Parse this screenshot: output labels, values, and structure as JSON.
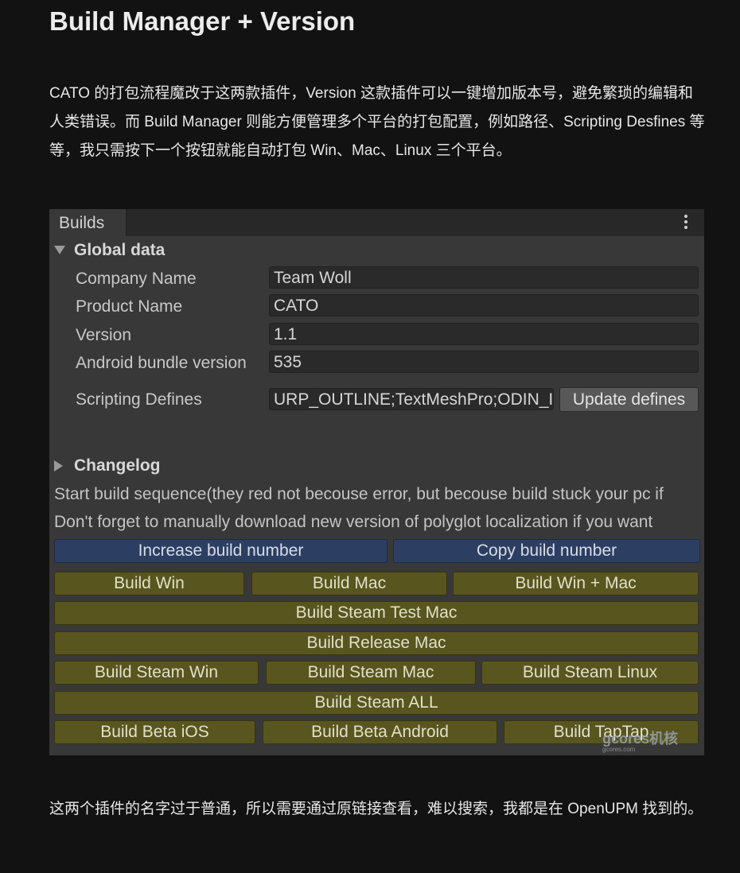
{
  "article": {
    "title": "Build Manager + Version",
    "paragraph1": "CATO 的打包流程魔改于这两款插件，Version 这款插件可以一键增加版本号，避免繁琐的编辑和人类错误。而 Build Manager 则能方便管理多个平台的打包配置，例如路径、Scripting Desfines 等等，我只需按下一个按钮就能自动打包 Win、Mac、Linux 三个平台。",
    "paragraph2": "这两个插件的名字过于普通，所以需要通过原链接查看，难以搜索，我都是在 OpenUPM 找到的。",
    "watermark": "gcores机核",
    "watermark_sub": "gcores.com"
  },
  "window": {
    "tab_label": "Builds",
    "menu_icon": "kebab-menu-icon"
  },
  "global_data": {
    "header": "Global data",
    "fields": [
      {
        "label": "Company Name",
        "value": "Team Woll"
      },
      {
        "label": "Product Name",
        "value": "CATO"
      },
      {
        "label": "Version",
        "value": "1.1"
      },
      {
        "label": "Android bundle version",
        "value": "535"
      }
    ],
    "scripting": {
      "label": "Scripting Defines",
      "value": "URP_OUTLINE;TextMeshPro;ODIN_INSPECTOR",
      "button": "Update defines"
    }
  },
  "changelog": {
    "header": "Changelog",
    "info_line1": "Start build sequence(they red not becouse error, but becouse build stuck your pc if",
    "info_line2": "Don't forget to manually download new version of polyglot localization if you want"
  },
  "buttons": {
    "increase": "Increase build number",
    "copy": "Copy build number",
    "build_win": "Build Win",
    "build_mac": "Build Mac",
    "build_win_mac": "Build Win + Mac",
    "steam_test_mac": "Build Steam Test Mac",
    "release_mac": "Build Release Mac",
    "steam_win": "Build Steam Win",
    "steam_mac": "Build Steam Mac",
    "steam_linux": "Build Steam Linux",
    "steam_all": "Build Steam ALL",
    "beta_ios": "Build Beta iOS",
    "beta_android": "Build Beta Android",
    "taptap": "Build TapTap"
  },
  "colors": {
    "blue_button": "#2c3f63",
    "olive_button": "#58551f",
    "panel": "#383838"
  }
}
